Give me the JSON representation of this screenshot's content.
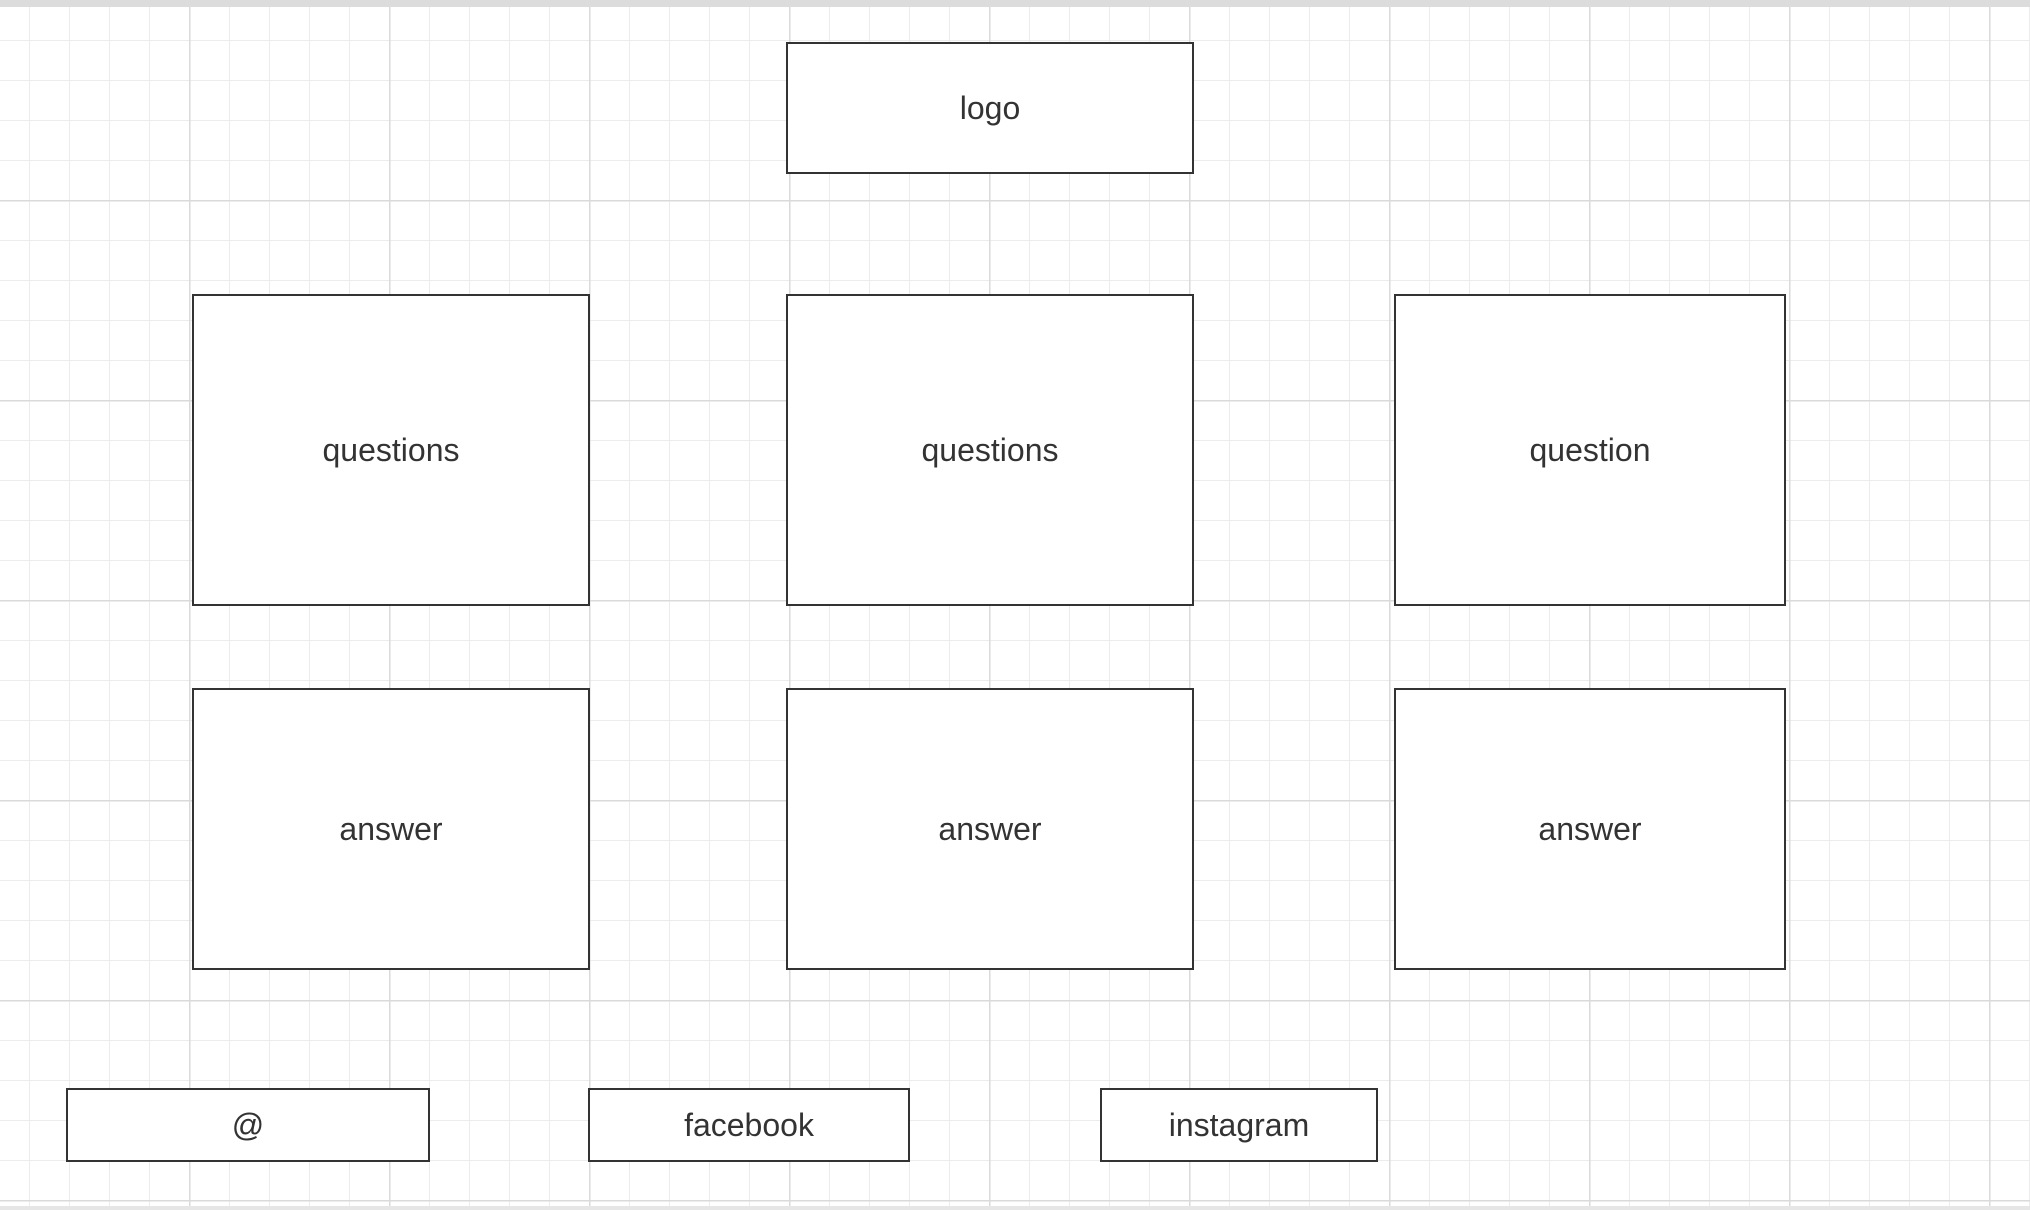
{
  "colors": {
    "box_border": "#333333",
    "box_fill": "#ffffff",
    "text": "#333333",
    "grid_major": "#dadada",
    "grid_minor": "#ececec"
  },
  "header": {
    "logo_label": "logo"
  },
  "questions_row": [
    {
      "label": "questions"
    },
    {
      "label": "questions"
    },
    {
      "label": "question"
    }
  ],
  "answers_row": [
    {
      "label": "answer"
    },
    {
      "label": "answer"
    },
    {
      "label": "answer"
    }
  ],
  "footer": {
    "items": [
      {
        "label": "@"
      },
      {
        "label": "facebook"
      },
      {
        "label": "instagram"
      }
    ]
  }
}
